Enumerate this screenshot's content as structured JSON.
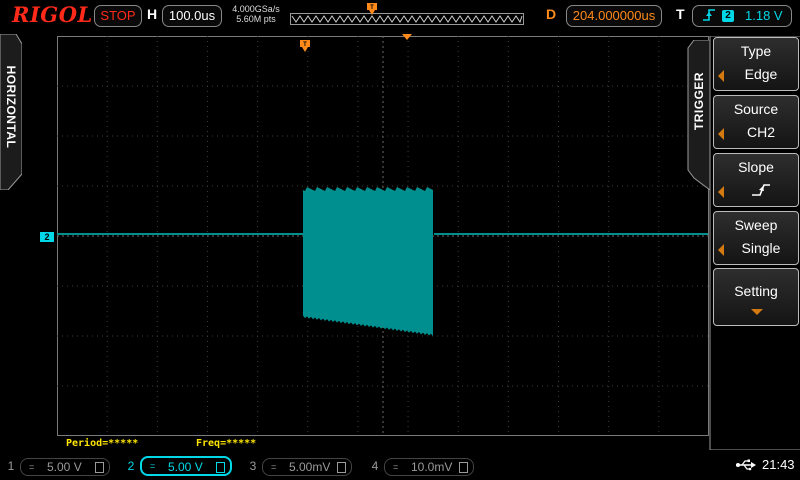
{
  "brand": "RIGOL",
  "status": "STOP",
  "horizontal": {
    "label": "H",
    "timebase": "100.0us",
    "sample_rate": "4.000GSa/s",
    "memory_depth": "5.60M pts",
    "tab_label": "HORIZONTAL"
  },
  "delay": {
    "label": "D",
    "value": "204.000000us"
  },
  "trigger_status": {
    "label": "T",
    "source_badge": "2",
    "level": "1.18 V",
    "slope_icon": "rising-edge-icon"
  },
  "channel_marker": "2",
  "measurements": {
    "period": "Period=*****",
    "freq": "Freq=*****"
  },
  "trigger_menu": {
    "title": "TRIGGER",
    "items": [
      {
        "label": "Type",
        "value": "Edge"
      },
      {
        "label": "Source",
        "value": "CH2"
      },
      {
        "label": "Slope",
        "value": "",
        "icon": "rising-edge-icon"
      },
      {
        "label": "Sweep",
        "value": "Single"
      },
      {
        "label": "Setting",
        "value": ""
      }
    ]
  },
  "channels": [
    {
      "num": "1",
      "coupling": "=",
      "scale": "5.00 V"
    },
    {
      "num": "2",
      "coupling": "=",
      "scale": "5.00 V"
    },
    {
      "num": "3",
      "coupling": "=",
      "scale": "5.00mV"
    },
    {
      "num": "4",
      "coupling": "=",
      "scale": "10.0mV"
    }
  ],
  "clock": "21:43",
  "colors": {
    "ch2": "#00d8e8",
    "trace": "#008f8f",
    "brand": "#ff2a1a",
    "delay": "#ff8a1a",
    "measure": "#ffe600",
    "grid": "#5a5a5a",
    "menu_arrow": "#d47a10"
  }
}
